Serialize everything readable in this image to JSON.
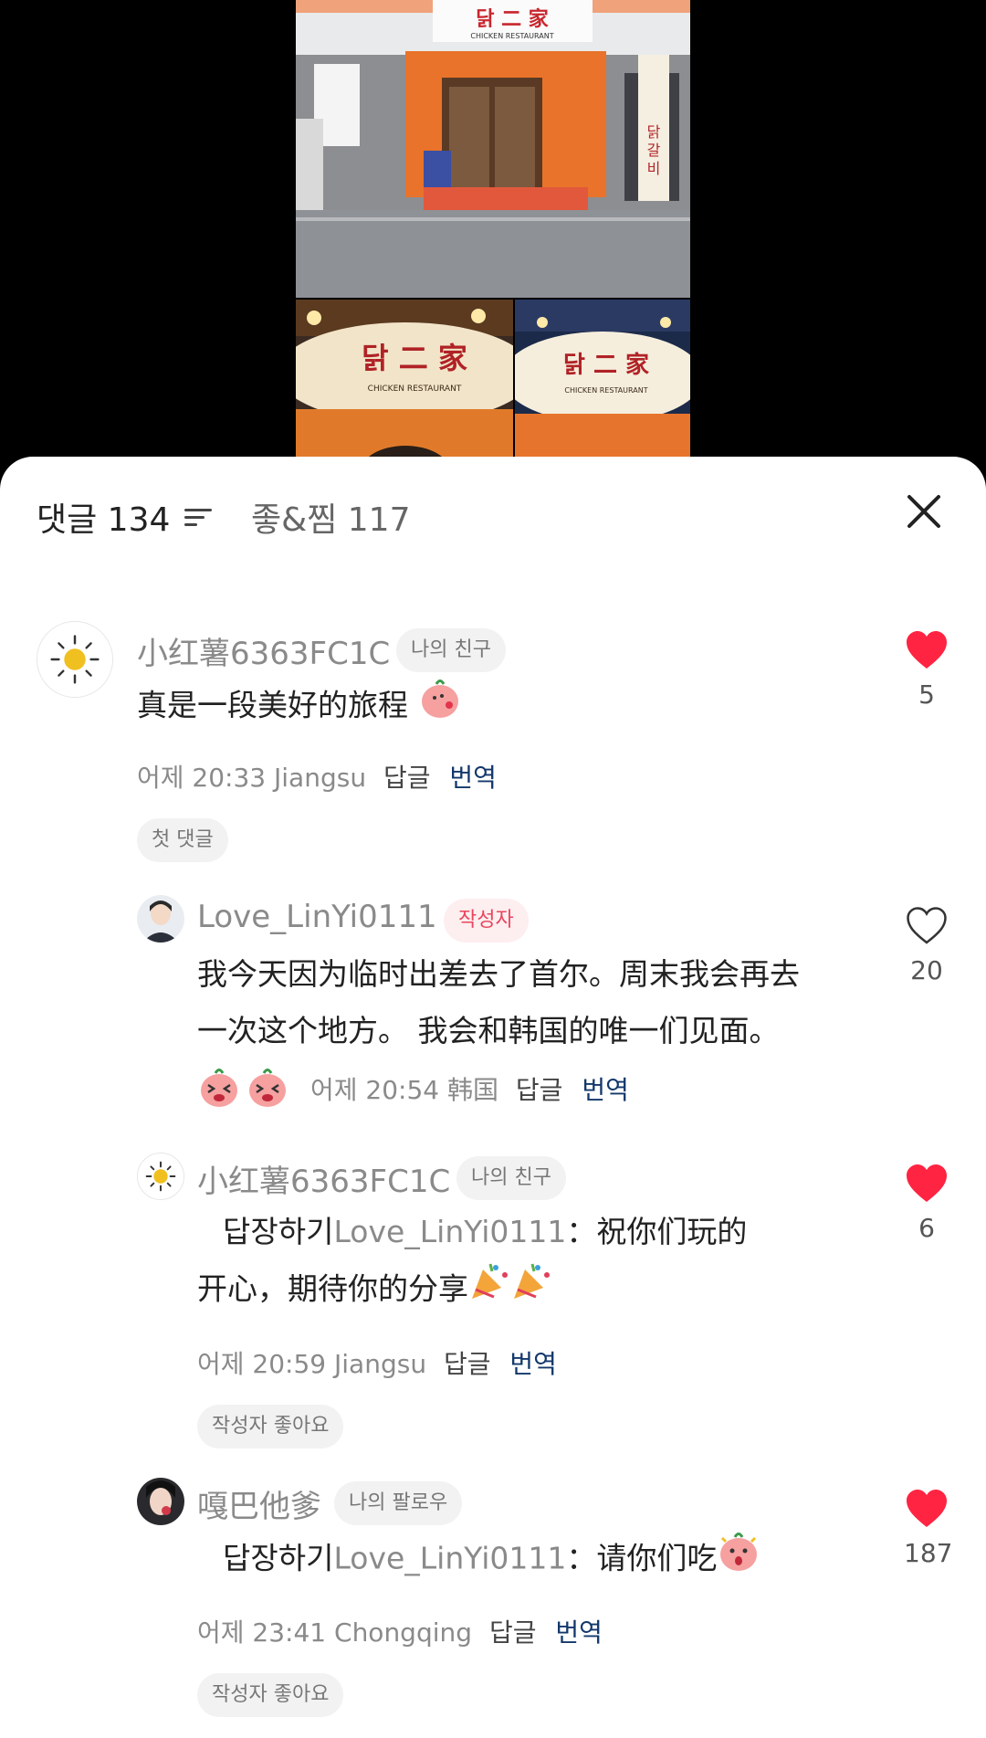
{
  "header": {
    "comments_tab": "댓글 134",
    "likes_tab": "좋&찜 117"
  },
  "photo": {
    "sign_main": "CHICKEN RESTAURANT",
    "sign_small_a": "CHICKEN RESTAURANT",
    "sign_small_b": "CHICKEN RESTAURANT"
  },
  "comments": [
    {
      "username": "小红薯6363FC1C",
      "badge": "나의 친구",
      "text": "真是一段美好的旅程",
      "meta_time": "어제 20:33 Jiangsu",
      "reply_label": "답글",
      "translate_label": "번역",
      "chip": "첫 댓글",
      "likes": "5",
      "liked": true
    },
    {
      "username": "Love_LinYi0111",
      "badge": "작성자",
      "text_line1": "我今天因为临时出差去了首尔。周末我会再去",
      "text_line2": "一次这个地方。 我会和韩国的唯一们见面。",
      "meta_time": "어제 20:54 韩国",
      "reply_label": "답글",
      "translate_label": "번역",
      "likes": "20",
      "liked": false
    },
    {
      "username": "小红薯6363FC1C",
      "badge": "나의 친구",
      "reply_prefix": "답장하기",
      "mention": "Love_LinYi0111",
      "text_line1": "：祝你们玩的",
      "text_line2": "开心，期待你的分享",
      "meta_time": "어제 20:59 Jiangsu",
      "reply_label": "답글",
      "translate_label": "번역",
      "chip": "작성자 좋아요",
      "likes": "6",
      "liked": true
    },
    {
      "username": "嘎巴他爹",
      "badge": "나의 팔로우",
      "reply_prefix": "답장하기",
      "mention": "Love_LinYi0111",
      "text_line1": "：请你们吃",
      "meta_time": "어제 23:41 Chongqing",
      "reply_label": "답글",
      "translate_label": "번역",
      "chip": "작성자 좋아요",
      "likes": "187",
      "liked": true
    }
  ],
  "colors": {
    "like_red": "#ff2442",
    "translate_blue": "#13386b",
    "author_badge": "#e8465d"
  }
}
